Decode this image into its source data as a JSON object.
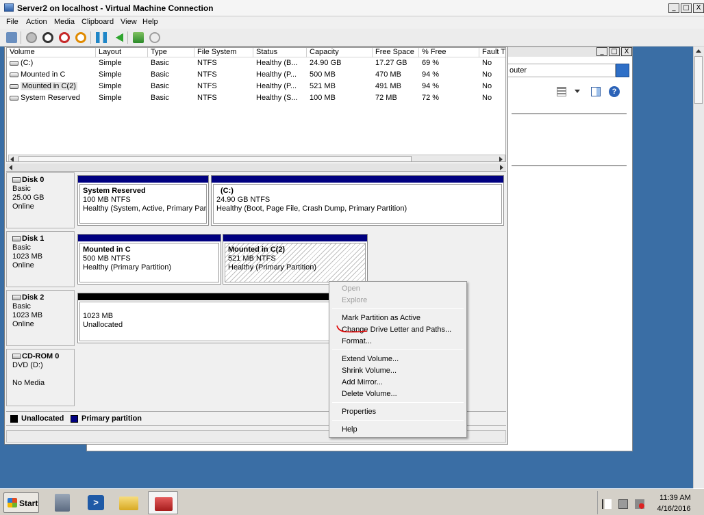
{
  "window": {
    "title": "Server2 on localhost - Virtual Machine Connection",
    "minimize": "_",
    "maximize": "□",
    "close": "X"
  },
  "menubar": [
    "File",
    "Action",
    "Media",
    "Clipboard",
    "View",
    "Help"
  ],
  "toolbar_icons": [
    "ctrl-alt-del-icon",
    "start-icon",
    "turn-off-icon",
    "shut-down-icon",
    "save-icon",
    "pause-icon",
    "resume-icon",
    "checkpoint-icon",
    "revert-icon"
  ],
  "colors": {
    "desktop": "#3a6ea5",
    "primary_partition": "#000080",
    "unallocated": "#000000",
    "annotation": "#e00000"
  },
  "background_window": {
    "search_text": "outer"
  },
  "volume_list": {
    "columns": [
      "Volume",
      "Layout",
      "Type",
      "File System",
      "Status",
      "Capacity",
      "Free Space",
      "% Free",
      "Fault T"
    ],
    "rows": [
      {
        "volume": "(C:)",
        "layout": "Simple",
        "type": "Basic",
        "fs": "NTFS",
        "status": "Healthy (B...",
        "capacity": "24.90 GB",
        "free": "17.27 GB",
        "pct": "69 %",
        "fault": "No"
      },
      {
        "volume": "Mounted in C",
        "layout": "Simple",
        "type": "Basic",
        "fs": "NTFS",
        "status": "Healthy (P...",
        "capacity": "500 MB",
        "free": "470 MB",
        "pct": "94 %",
        "fault": "No"
      },
      {
        "volume": "Mounted in C(2)",
        "layout": "Simple",
        "type": "Basic",
        "fs": "NTFS",
        "status": "Healthy (P...",
        "capacity": "521 MB",
        "free": "491 MB",
        "pct": "94 %",
        "fault": "No"
      },
      {
        "volume": "System Reserved",
        "layout": "Simple",
        "type": "Basic",
        "fs": "NTFS",
        "status": "Healthy (S...",
        "capacity": "100 MB",
        "free": "72 MB",
        "pct": "72 %",
        "fault": "No"
      }
    ]
  },
  "disks": [
    {
      "name": "Disk 0",
      "type": "Basic",
      "size": "25.00 GB",
      "state": "Online",
      "partitions": [
        {
          "title": "System Reserved",
          "size": "100 MB NTFS",
          "status": "Healthy (System, Active, Primary Part"
        },
        {
          "title": "(C:)",
          "size": "24.90 GB NTFS",
          "status": "Healthy (Boot, Page File, Crash Dump, Primary Partition)"
        }
      ]
    },
    {
      "name": "Disk 1",
      "type": "Basic",
      "size": "1023 MB",
      "state": "Online",
      "partitions": [
        {
          "title": "Mounted in C",
          "size": "500 MB NTFS",
          "status": "Healthy (Primary Partition)"
        },
        {
          "title": "Mounted in C(2)",
          "size": "521 MB NTFS",
          "status": "Healthy (Primary Partition)"
        }
      ]
    },
    {
      "name": "Disk 2",
      "type": "Basic",
      "size": "1023 MB",
      "state": "Online",
      "partitions": [
        {
          "size": "1023 MB",
          "status": "Unallocated"
        }
      ]
    },
    {
      "name": "CD-ROM 0",
      "type": "DVD (D:)",
      "state": "No Media"
    }
  ],
  "legend": {
    "unallocated": "Unallocated",
    "primary": "Primary partition"
  },
  "context_menu": {
    "items": [
      {
        "label": "Open",
        "enabled": false
      },
      {
        "label": "Explore",
        "enabled": false
      },
      {
        "label": "Mark Partition as Active",
        "enabled": true
      },
      {
        "label": "Change Drive Letter and Paths...",
        "enabled": true
      },
      {
        "label": "Format...",
        "enabled": true
      },
      {
        "label": "Extend Volume...",
        "enabled": true
      },
      {
        "label": "Shrink Volume...",
        "enabled": true
      },
      {
        "label": "Add Mirror...",
        "enabled": true
      },
      {
        "label": "Delete Volume...",
        "enabled": true
      },
      {
        "label": "Properties",
        "enabled": true
      },
      {
        "label": "Help",
        "enabled": true
      }
    ]
  },
  "taskbar": {
    "start_label": "Start",
    "time": "11:39 AM",
    "date": "4/16/2016"
  }
}
